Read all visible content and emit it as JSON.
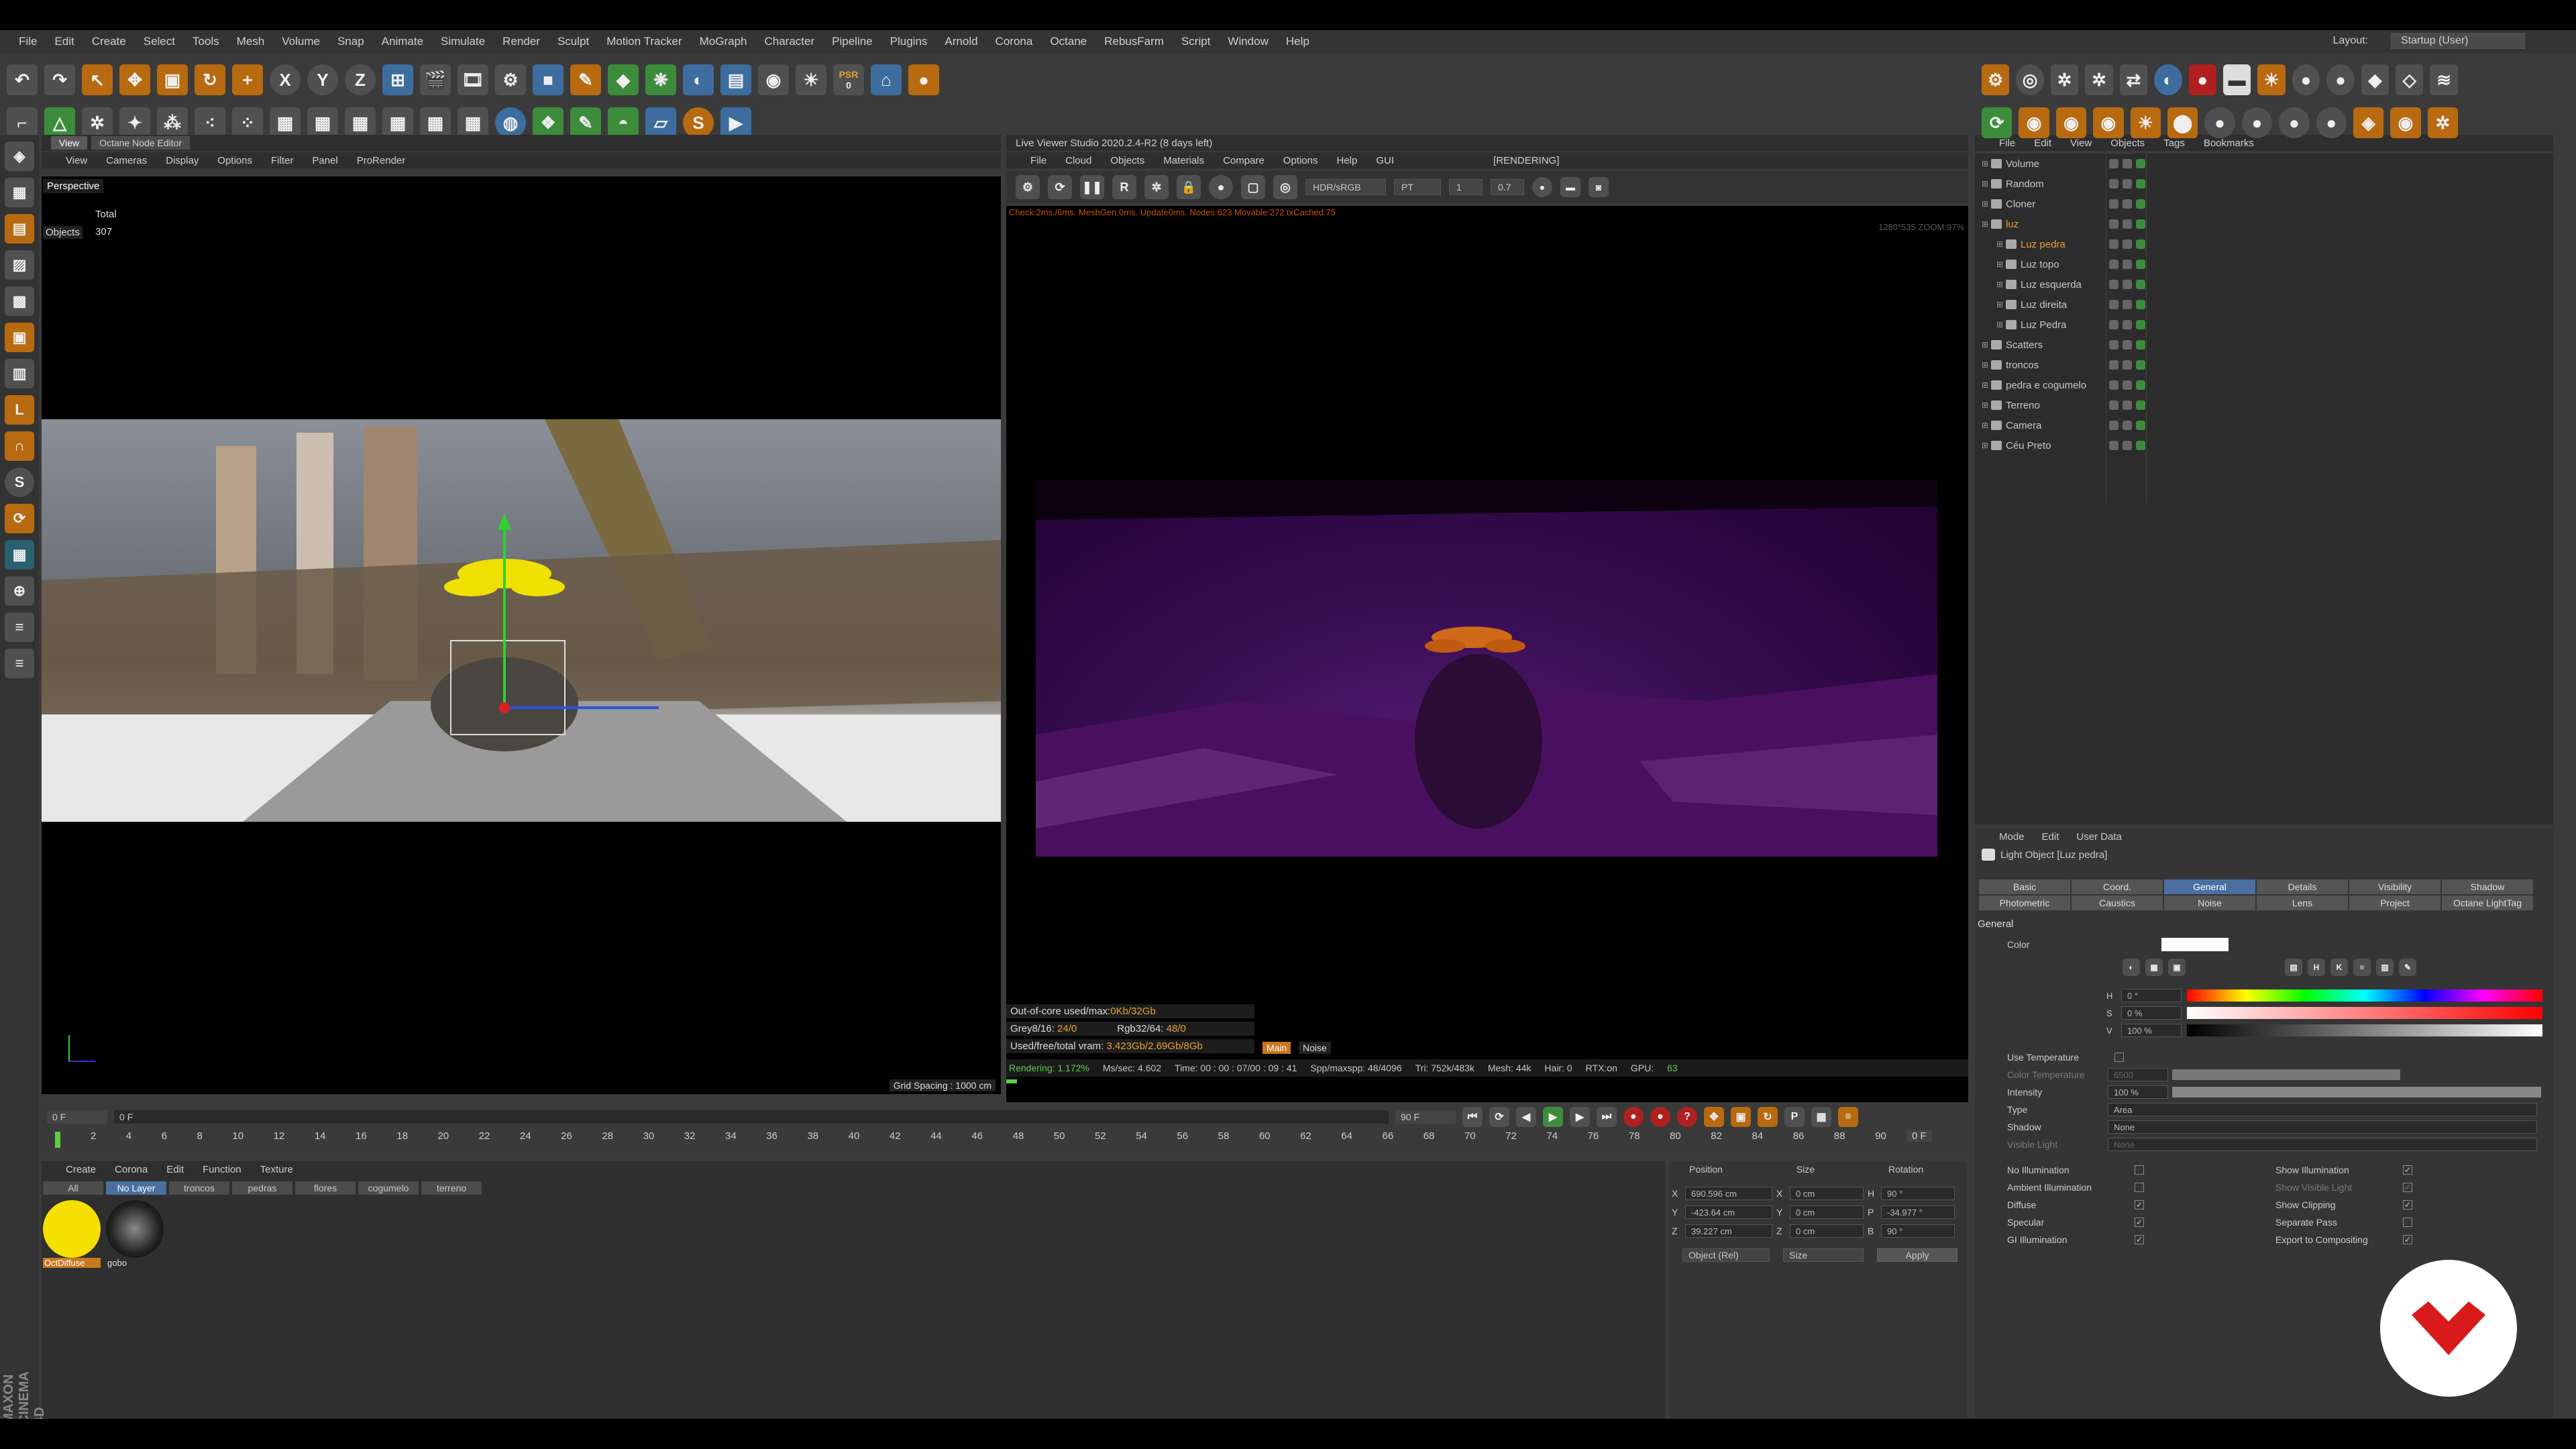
{
  "menu": [
    "File",
    "Edit",
    "Create",
    "Select",
    "Tools",
    "Mesh",
    "Volume",
    "Snap",
    "Animate",
    "Simulate",
    "Render",
    "Sculpt",
    "Motion Tracker",
    "MoGraph",
    "Character",
    "Pipeline",
    "Plugins",
    "Arnold",
    "Corona",
    "Octane",
    "RebusFarm",
    "Script",
    "Window",
    "Help"
  ],
  "layout": {
    "label": "Layout:",
    "value": "Startup (User)"
  },
  "toolbar": {
    "psr_label": "PSR",
    "psr_value": "0",
    "axes": [
      "X",
      "Y",
      "Z"
    ]
  },
  "viewport": {
    "tabs": [
      "View",
      "Octane Node Editor"
    ],
    "menu": [
      "View",
      "Cameras",
      "Display",
      "Options",
      "Filter",
      "Panel",
      "ProRender"
    ],
    "title": "Perspective",
    "stats_header": "Total",
    "stats_label": "Objects",
    "stats_value": "307",
    "grid_spacing": "Grid Spacing : 1000 cm"
  },
  "live_viewer": {
    "title": "Live Viewer Studio 2020.2.4-R2 (8 days left)",
    "menu": [
      "File",
      "Cloud",
      "Objects",
      "Materials",
      "Compare",
      "Options",
      "Help",
      "GUI"
    ],
    "status": "[RENDERING]",
    "hdr": "HDR/sRGB",
    "mode": "PT",
    "val1": "1",
    "val2": "0.7",
    "check": "Check:2ms./6ms. MeshGen:0ms. Update0ms. Nodes:623 Movable:272 txCached:75",
    "resolution": "1280*535 ZOOM:97%",
    "out_of_core_label": "Out-of-core used/max:",
    "out_of_core_value": "0Kb/32Gb",
    "grey_label": "Grey8/16:",
    "grey_value": "24/0",
    "rgb_label": "Rgb32/64:",
    "rgb_value": "48/0",
    "vram_label": "Used/free/total vram:",
    "vram_value": "3.423Gb/2.69Gb/8Gb",
    "main_btn": "Main",
    "noise_btn": "Noise",
    "rendering": "Rendering: 1.172%",
    "ms_sec": "Ms/sec: 4.602",
    "time": "Time: 00 : 00 : 07/00 : 09 : 41",
    "spp": "Spp/maxspp: 48/4096",
    "tri": "Tri: 752k/483k",
    "mesh": "Mesh: 44k",
    "hair": "Hair: 0",
    "rtx": "RTX:on",
    "gpu": "GPU:",
    "gpu_val": "63"
  },
  "timeline": {
    "start": "0 F",
    "field2": "0 F",
    "end": "90 F",
    "end2": "90 F",
    "current": "0 F",
    "ticks": [
      "0",
      "2",
      "4",
      "6",
      "8",
      "10",
      "12",
      "14",
      "16",
      "18",
      "20",
      "22",
      "24",
      "26",
      "28",
      "30",
      "32",
      "34",
      "36",
      "38",
      "40",
      "42",
      "44",
      "46",
      "48",
      "50",
      "52",
      "54",
      "56",
      "58",
      "60",
      "62",
      "64",
      "66",
      "68",
      "70",
      "72",
      "74",
      "76",
      "78",
      "80",
      "82",
      "84",
      "86",
      "88",
      "90"
    ]
  },
  "materials": {
    "menu": [
      "Create",
      "Corona",
      "Edit",
      "Function",
      "Texture"
    ],
    "layers": [
      "All",
      "No Layer",
      "troncos",
      "pedras",
      "flores",
      "cogumelo",
      "terreno"
    ],
    "items": [
      {
        "name": "OctDiffuse",
        "color": "#f5e000"
      },
      {
        "name": "gobo",
        "color": "#222"
      }
    ]
  },
  "coords": {
    "headers": [
      "Position",
      "Size",
      "Rotation"
    ],
    "rows": [
      {
        "axis": "X",
        "pos": "690.596 cm",
        "size": "0 cm",
        "raxis": "H",
        "rot": "90 °"
      },
      {
        "axis": "Y",
        "pos": "-423.64 cm",
        "size": "0 cm",
        "raxis": "P",
        "rot": "-34.977 °"
      },
      {
        "axis": "Z",
        "pos": "39.227 cm",
        "size": "0 cm",
        "raxis": "B",
        "rot": "90 °"
      }
    ],
    "mode": "Object (Rel)",
    "size_mode": "Size",
    "apply": "Apply"
  },
  "objects": {
    "menu": [
      "File",
      "Edit",
      "View",
      "Objects",
      "Tags",
      "Bookmarks"
    ],
    "list": [
      {
        "name": "Volume",
        "indent": 0,
        "color": "#c8c8c8"
      },
      {
        "name": "Random",
        "indent": 0,
        "color": "#c8c8c8"
      },
      {
        "name": "Cloner",
        "indent": 0,
        "color": "#c8c8c8"
      },
      {
        "name": "luz",
        "indent": 0,
        "color": "#e8a030"
      },
      {
        "name": "Luz pedra",
        "indent": 1,
        "color": "#e8a030"
      },
      {
        "name": "Luz topo",
        "indent": 1,
        "color": "#c8c8c8"
      },
      {
        "name": "Luz esquerda",
        "indent": 1,
        "color": "#c8c8c8"
      },
      {
        "name": "Luz direita",
        "indent": 1,
        "color": "#c8c8c8"
      },
      {
        "name": "Luz Pedra",
        "indent": 1,
        "color": "#c8c8c8"
      },
      {
        "name": "Scatters",
        "indent": 0,
        "color": "#c8c8c8"
      },
      {
        "name": "troncos",
        "indent": 0,
        "color": "#c8c8c8"
      },
      {
        "name": "pedra e cogumelo",
        "indent": 0,
        "color": "#c8c8c8"
      },
      {
        "name": "Terreno",
        "indent": 0,
        "color": "#c8c8c8"
      },
      {
        "name": "Camera",
        "indent": 0,
        "color": "#c8c8c8"
      },
      {
        "name": "Céu Preto",
        "indent": 0,
        "color": "#c8c8c8"
      }
    ]
  },
  "attributes": {
    "menu": [
      "Mode",
      "Edit",
      "User Data"
    ],
    "title": "Light Object [Luz pedra]",
    "tabs_row1": [
      "Basic",
      "Coord.",
      "General",
      "Details",
      "Visibility",
      "Shadow"
    ],
    "tabs_row2": [
      "Photometric",
      "Caustics",
      "Noise",
      "Lens",
      "Project",
      "Octane LightTag"
    ],
    "section": "General",
    "color_label": "Color",
    "h_label": "H",
    "h_val": "0 °",
    "s_label": "S",
    "s_val": "0 %",
    "v_label": "V",
    "v_val": "100 %",
    "use_temp": "Use Temperature",
    "color_temp": "Color Temperature",
    "color_temp_val": "6500",
    "intensity": "Intensity",
    "intensity_val": "100 %",
    "type": "Type",
    "type_val": "Area",
    "shadow": "Shadow",
    "shadow_val": "None",
    "visible_light": "Visible Light",
    "visible_light_val": "None",
    "checks_left": [
      "No Illumination",
      "Ambient Illumination",
      "Diffuse",
      "Specular",
      "GI Illumination"
    ],
    "checks_right": [
      "Show Illumination",
      "Show Visible Light",
      "Show Clipping",
      "Separate Pass",
      "Export to Compositing"
    ]
  },
  "brand_side": "AXON\nNEMA 4D"
}
